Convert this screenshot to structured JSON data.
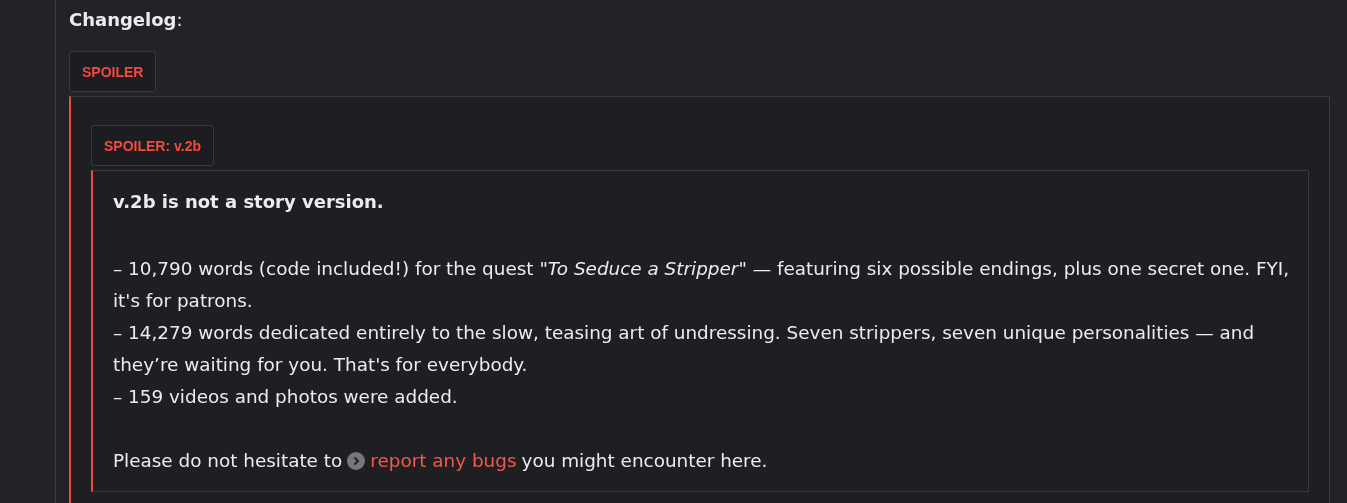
{
  "heading": "**Changelog**:",
  "spoiler": {
    "label": "SPOILER",
    "inner": {
      "label": "SPOILER: v.2b",
      "title": "v.2b is not a story version.",
      "items": [
        "– 10,790 words (code included!) for the quest *\"To Seduce a Stripper\"* — featuring six possible endings, plus one secret one. FYI, it's for patrons.",
        "– 14,279 words dedicated entirely to the slow, teasing art of undressing. Seven strippers, seven unique personalities — and they’re waiting for you. That's for everybody.",
        "– 159 videos and photos were added."
      ],
      "footer": {
        "before": "Please do not hesitate to",
        "link": "report any bugs",
        "after": "you might encounter here."
      }
    }
  }
}
